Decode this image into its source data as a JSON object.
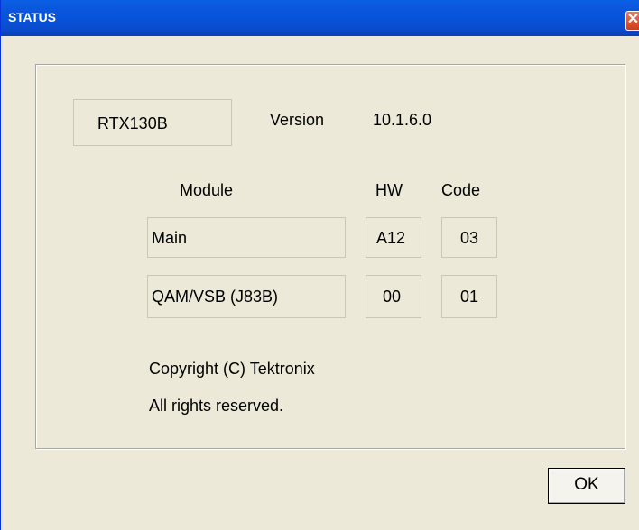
{
  "window": {
    "title": "STATUS",
    "close_icon": "close-icon"
  },
  "device": {
    "model": "RTX130B",
    "version_label": "Version",
    "version_value": "10.1.6.0"
  },
  "table": {
    "headers": {
      "module": "Module",
      "hw": "HW",
      "code": "Code"
    },
    "rows": [
      {
        "module": "Main",
        "hw": "A12",
        "code": "03"
      },
      {
        "module": "QAM/VSB (J83B)",
        "hw": "00",
        "code": "01"
      }
    ]
  },
  "footer": {
    "copyright": "Copyright (C) Tektronix",
    "rights": "All rights reserved."
  },
  "buttons": {
    "ok": "OK"
  },
  "colors": {
    "titlebar": "#0653da",
    "close": "#cc3d1a",
    "background": "#ece9d8"
  }
}
